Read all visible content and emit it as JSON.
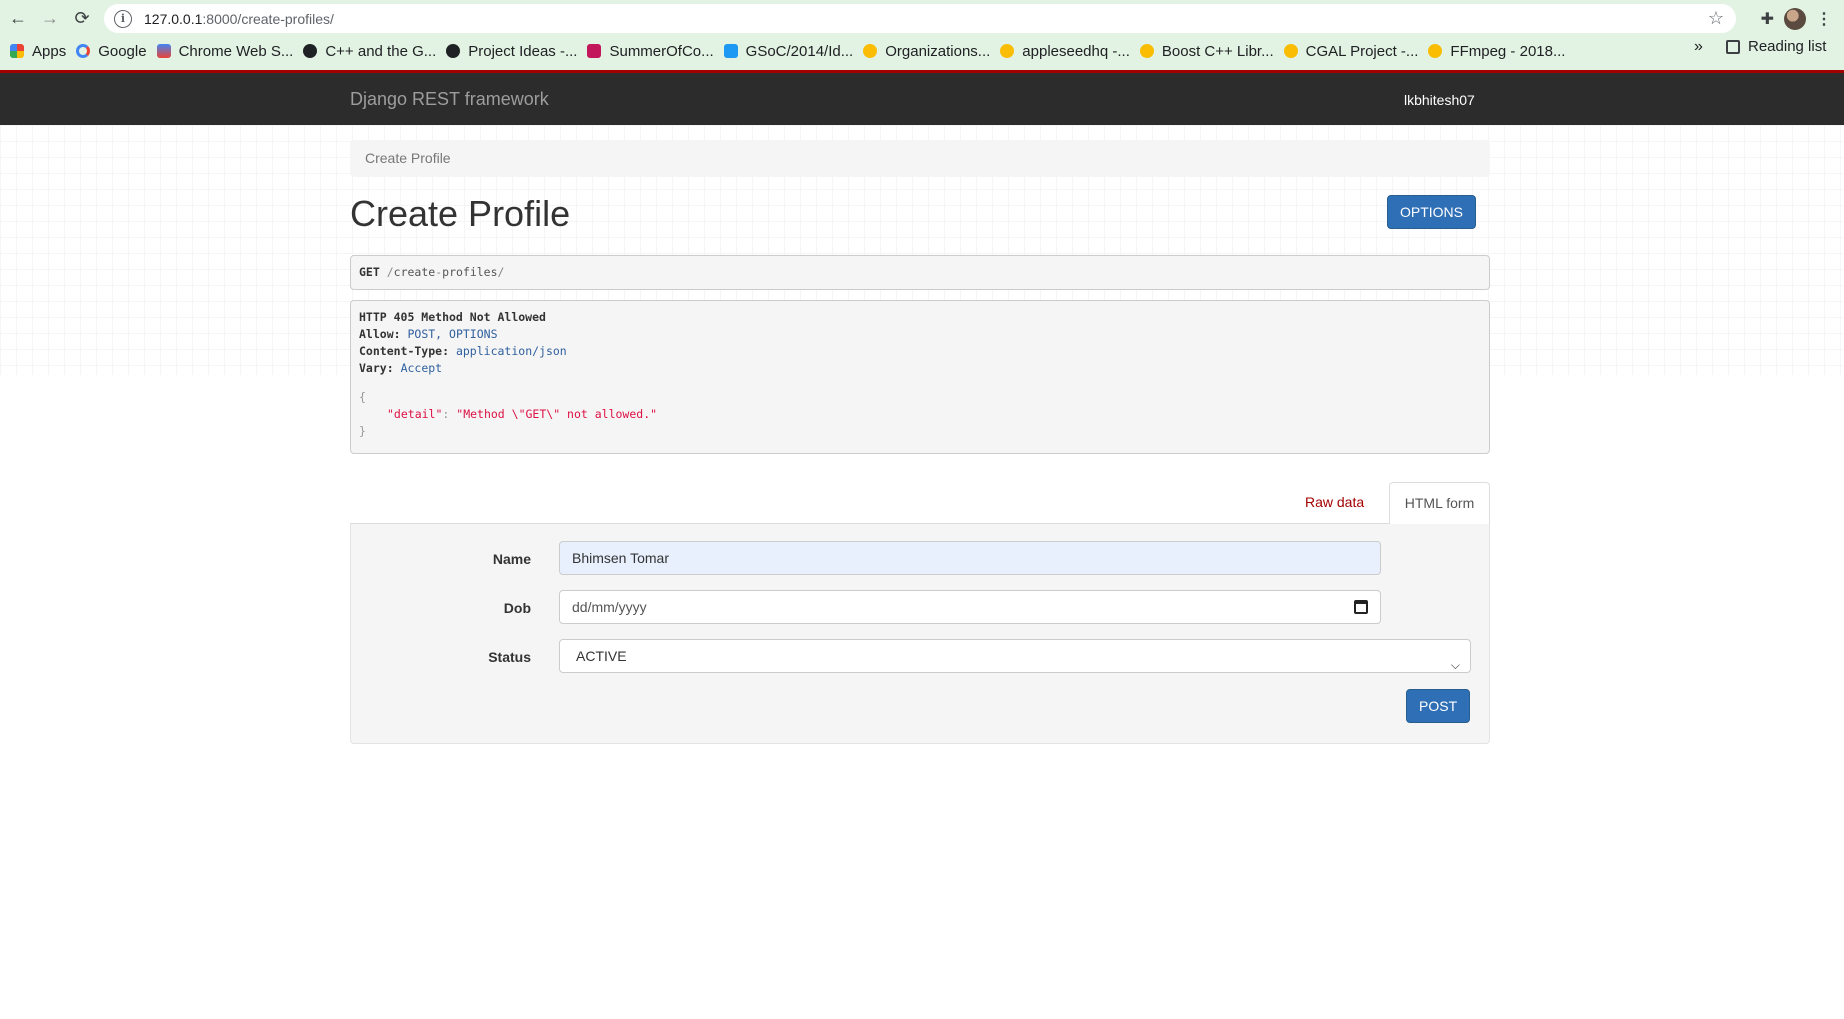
{
  "browser": {
    "url_host": "127.0.0.1",
    "url_path": ":8000/create-profiles/",
    "bookmarks": [
      {
        "label": "Apps",
        "color": "#ea4335"
      },
      {
        "label": "Google",
        "color": "#4285f4"
      },
      {
        "label": "Chrome Web S...",
        "color": "#f4b400"
      },
      {
        "label": "C++ and the G...",
        "color": "#202124"
      },
      {
        "label": "Project Ideas -...",
        "color": "#202124"
      },
      {
        "label": "SummerOfCo...",
        "color": "#c2185b"
      },
      {
        "label": "GSoC/2014/Id...",
        "color": "#1d99f3"
      },
      {
        "label": "Organizations...",
        "color": "#fbbc04"
      },
      {
        "label": "appleseedhq -...",
        "color": "#fbbc04"
      },
      {
        "label": "Boost C++ Libr...",
        "color": "#fbbc04"
      },
      {
        "label": "CGAL Project -...",
        "color": "#fbbc04"
      },
      {
        "label": "FFmpeg - 2018...",
        "color": "#fbbc04"
      }
    ],
    "more_label": "»",
    "reading_list": "Reading list"
  },
  "navbar": {
    "brand": "Django REST framework",
    "user": "lkbhitesh07"
  },
  "breadcrumb": "Create Profile",
  "page_title": "Create Profile",
  "options_label": "OPTIONS",
  "request": {
    "method": "GET",
    "path_parts": [
      "/",
      "create",
      "-",
      "profiles",
      "/"
    ]
  },
  "response": {
    "status": "HTTP 405 Method Not Allowed",
    "headers": [
      {
        "key": "Allow:",
        "value": "POST, OPTIONS"
      },
      {
        "key": "Content-Type:",
        "value": "application/json"
      },
      {
        "key": "Vary:",
        "value": "Accept"
      }
    ],
    "open_brace": "{",
    "json_key": "\"detail\"",
    "json_colon": ":",
    "json_value": "\"Method \\\"GET\\\" not allowed.\"",
    "close_brace": "}"
  },
  "tabs": {
    "raw": "Raw data",
    "html": "HTML form"
  },
  "form": {
    "name_label": "Name",
    "name_value": "Bhimsen Tomar",
    "dob_label": "Dob",
    "dob_placeholder": "dd/mm/yyyy",
    "status_label": "Status",
    "status_value": "ACTIVE",
    "post_label": "POST"
  }
}
